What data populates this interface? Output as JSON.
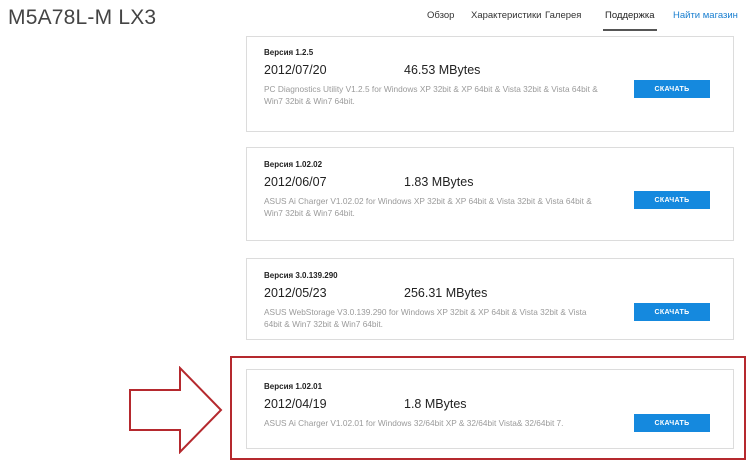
{
  "product": {
    "title": "M5A78L-M LX3"
  },
  "nav": {
    "items": [
      {
        "label": "Обзор"
      },
      {
        "label": "Характеристики"
      },
      {
        "label": "Галерея"
      },
      {
        "label": "Поддержка"
      },
      {
        "label": "Найти магазин"
      }
    ],
    "active_index": 3
  },
  "downloads": [
    {
      "version": "Версия 1.2.5",
      "date": "2012/07/20",
      "size": "46.53 MBytes",
      "description": "PC Diagnostics Utility V1.2.5 for Windows XP 32bit & XP 64bit & Vista 32bit & Vista 64bit & Win7 32bit & Win7 64bit.",
      "button": "СКАЧАТЬ"
    },
    {
      "version": "Версия 1.02.02",
      "date": "2012/06/07",
      "size": "1.83 MBytes",
      "description": "ASUS Ai Charger V1.02.02 for Windows XP 32bit & XP 64bit & Vista 32bit & Vista 64bit & Win7 32bit & Win7 64bit.",
      "button": "СКАЧАТЬ"
    },
    {
      "version": "Версия 3.0.139.290",
      "date": "2012/05/23",
      "size": "256.31 MBytes",
      "description": "ASUS WebStorage V3.0.139.290 for Windows XP 32bit & XP 64bit & Vista 32bit & Vista 64bit & Win7 32bit & Win7 64bit.",
      "button": "СКАЧАТЬ"
    },
    {
      "version": "Версия 1.02.01",
      "date": "2012/04/19",
      "size": "1.8 MBytes",
      "description": "ASUS Ai Charger V1.02.01 for Windows 32/64bit XP & 32/64bit Vista& 32/64bit 7.",
      "button": "СКАЧАТЬ"
    }
  ],
  "colors": {
    "accent": "#1589de",
    "highlight": "#b5292e",
    "link": "#1a7fd0"
  }
}
